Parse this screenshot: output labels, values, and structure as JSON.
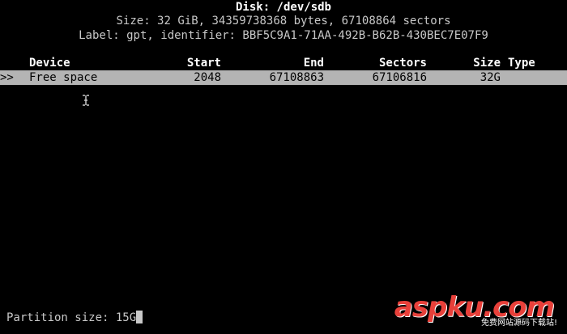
{
  "disk": {
    "title": "Disk: /dev/sdb",
    "size_info": "Size: 32 GiB, 34359738368 bytes, 67108864 sectors",
    "label_info": "Label: gpt, identifier: BBF5C9A1-71AA-492B-B62B-430BEC7E07F9"
  },
  "table": {
    "headers": {
      "device": "Device",
      "start": "Start",
      "end": "End",
      "sectors": "Sectors",
      "size": "Size",
      "type": "Type"
    },
    "rows": [
      {
        "marker": ">>",
        "device": "Free space",
        "start": "2048",
        "end": "67108863",
        "sectors": "67106816",
        "size": "32G",
        "type": ""
      }
    ]
  },
  "prompt": {
    "label": "Partition size: ",
    "value": "15G"
  },
  "watermark": {
    "brand": "aspku.com",
    "tagline": "免费网站源码下载站!"
  },
  "colors": {
    "background": "#000000",
    "text": "#c8c8c8",
    "selection": "#b4b4b4",
    "watermark": "#e8403a"
  },
  "icons": {
    "mouse_cursor": "i-beam-cursor-icon"
  }
}
